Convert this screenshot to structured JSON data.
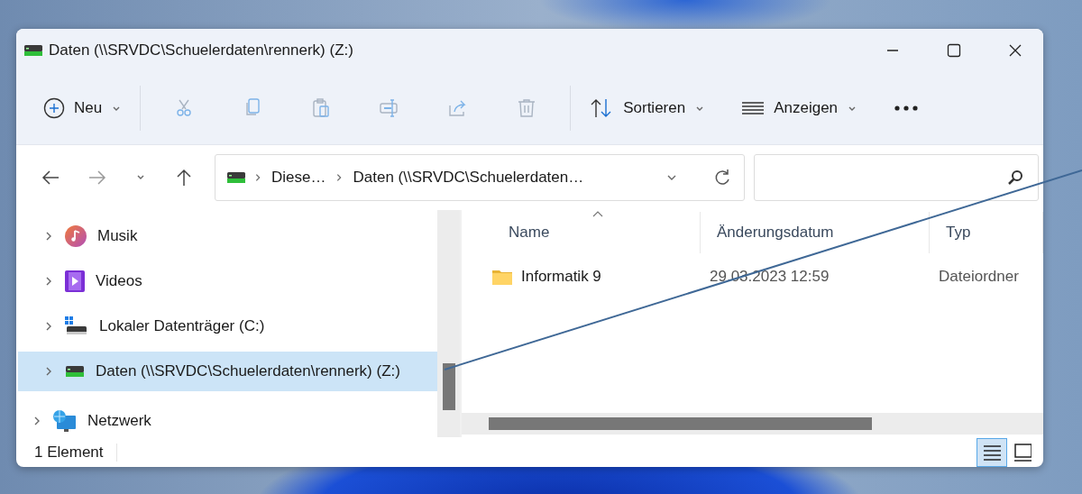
{
  "window": {
    "title": "Daten (\\\\SRVDC\\Schuelerdaten\\rennerk) (Z:)"
  },
  "toolbar": {
    "new": {
      "label": "Neu"
    },
    "actions": [
      {
        "kind": "cut",
        "disabled": true
      },
      {
        "kind": "copy",
        "disabled": true
      },
      {
        "kind": "paste",
        "disabled": true
      },
      {
        "kind": "rename",
        "disabled": true
      },
      {
        "kind": "share",
        "disabled": true
      },
      {
        "kind": "delete",
        "disabled": true
      }
    ],
    "sort": {
      "label": "Sortieren"
    },
    "view": {
      "label": "Anzeigen"
    }
  },
  "nav": {
    "back": {
      "disabled": false
    },
    "forward": {
      "disabled": true
    },
    "breadcrumbs": [
      "Diese…",
      "Daten (\\\\SRVDC\\Schuelerdaten…"
    ]
  },
  "sidebar": {
    "items": [
      {
        "children": [
          {
            "label": "Musik",
            "selected": false
          },
          {
            "label": "Videos",
            "selected": false
          },
          {
            "label": "Lokaler Datenträger (C:)",
            "selected": false
          },
          {
            "label": "Daten (\\\\SRVDC\\Schuelerdaten\\rennerk) (Z:)",
            "selected": true
          }
        ]
      },
      {
        "label": "Netzwerk",
        "selected": false
      }
    ]
  },
  "columns": [
    {
      "label": "Name",
      "sorted": true
    },
    {
      "label": "Änderungsdatum",
      "sorted": false
    },
    {
      "label": "Typ",
      "sorted": false
    }
  ],
  "rows": [
    {
      "name": "Informatik 9",
      "date": "29.03.2023 12:59",
      "type": "Dateiordner"
    }
  ],
  "status_bar": {
    "text": "1 Element",
    "views": [
      {
        "kind": "details",
        "selected": true
      },
      {
        "kind": "tiles",
        "selected": false
      }
    ]
  }
}
